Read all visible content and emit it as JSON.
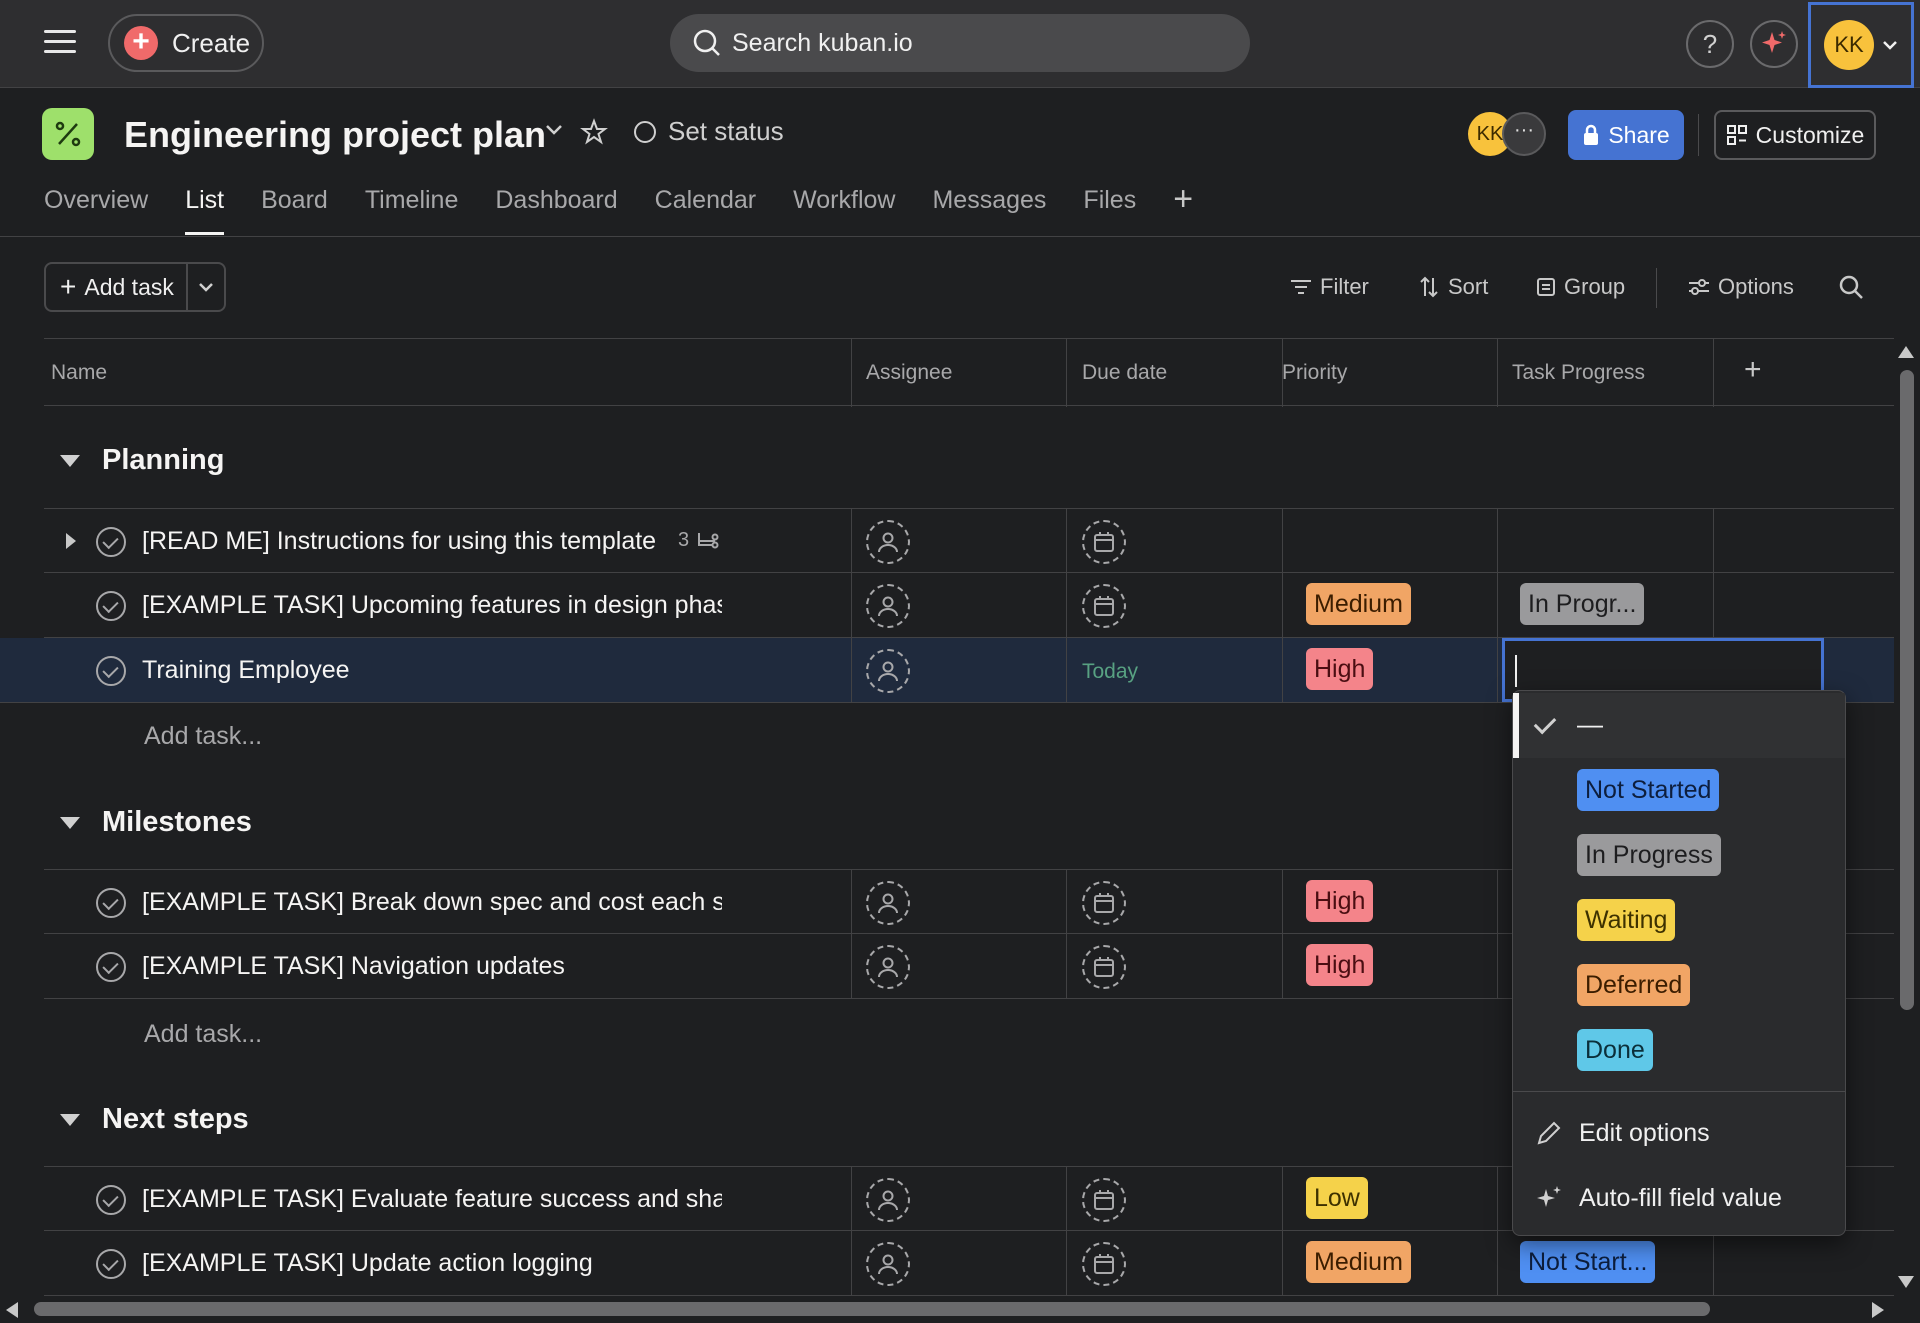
{
  "topbar": {
    "create_label": "Create",
    "search_placeholder": "Search kuban.io",
    "help_label": "?",
    "avatar_initials": "KK"
  },
  "project": {
    "title": "Engineering project plan",
    "set_status_label": "Set status",
    "member_initials": "KK",
    "more_members": "···",
    "share_label": "Share",
    "customize_label": "Customize"
  },
  "tabs": [
    {
      "label": "Overview"
    },
    {
      "label": "List",
      "active": true
    },
    {
      "label": "Board"
    },
    {
      "label": "Timeline"
    },
    {
      "label": "Dashboard"
    },
    {
      "label": "Calendar"
    },
    {
      "label": "Workflow"
    },
    {
      "label": "Messages"
    },
    {
      "label": "Files"
    }
  ],
  "toolbar": {
    "add_task_label": "Add task",
    "filter_label": "Filter",
    "sort_label": "Sort",
    "group_label": "Group",
    "options_label": "Options"
  },
  "columns": [
    "Name",
    "Assignee",
    "Due date",
    "Priority",
    "Task Progress",
    "+"
  ],
  "sections": [
    {
      "title": "Planning",
      "tasks": [
        {
          "name": "[READ ME] Instructions for using this template",
          "subtasks": "3",
          "due": "",
          "priority": "",
          "progress": ""
        },
        {
          "name": "[EXAMPLE TASK] Upcoming features in design phas",
          "due": "",
          "priority": "Medium",
          "progress": "In Progr..."
        },
        {
          "name": "Training Employee",
          "due": "Today",
          "priority": "High",
          "progress": ""
        }
      ],
      "add_task_label": "Add task..."
    },
    {
      "title": "Milestones",
      "tasks": [
        {
          "name": "[EXAMPLE TASK] Break down spec and cost each stc",
          "due": "",
          "priority": "High",
          "progress": ""
        },
        {
          "name": "[EXAMPLE TASK] Navigation updates",
          "due": "",
          "priority": "High",
          "progress": ""
        }
      ],
      "add_task_label": "Add task..."
    },
    {
      "title": "Next steps",
      "tasks": [
        {
          "name": "[EXAMPLE TASK] Evaluate feature success and share",
          "due": "",
          "priority": "Low",
          "progress": ""
        },
        {
          "name": "[EXAMPLE TASK] Update action logging",
          "due": "",
          "priority": "Medium",
          "progress": "Not Start..."
        }
      ]
    }
  ],
  "progress_dropdown": {
    "none_label": "—",
    "options": [
      {
        "label": "Not Started",
        "color": "#4f8ff2"
      },
      {
        "label": "In Progress",
        "color": "#9a9a9c"
      },
      {
        "label": "Waiting",
        "color": "#f5d24a"
      },
      {
        "label": "Deferred",
        "color": "#f1a565"
      },
      {
        "label": "Done",
        "color": "#5fc8e8"
      }
    ],
    "edit_options_label": "Edit options",
    "autofill_label": "Auto-fill field value"
  },
  "colors": {
    "accent": "#4573d2",
    "brand_red": "#f06a6a",
    "background": "#1e1f21"
  }
}
